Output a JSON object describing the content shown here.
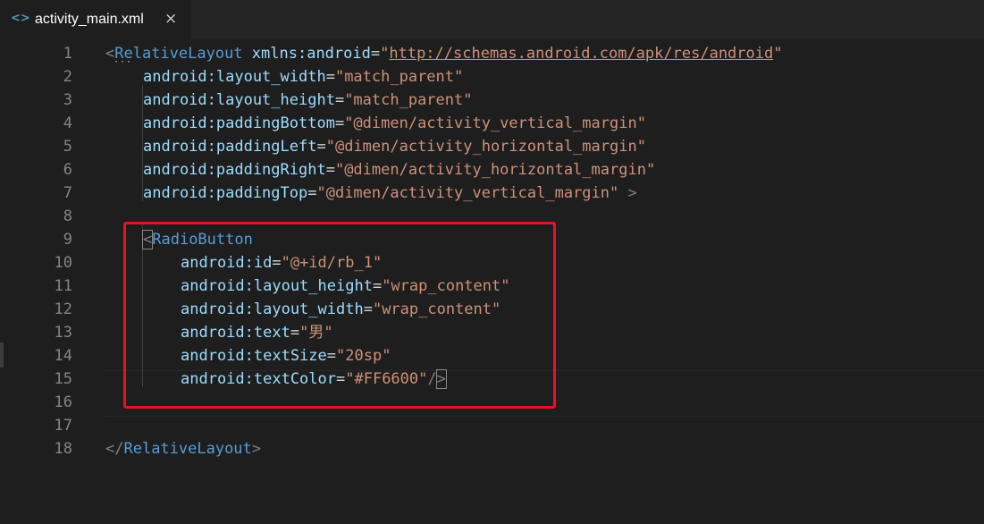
{
  "tab": {
    "icon": "code-icon",
    "icon_glyph": "<>",
    "label": "activity_main.xml",
    "close_glyph": "×"
  },
  "colors": {
    "highlight_box": "#e81123",
    "tag": "#569cd6",
    "attribute": "#9cdcfe",
    "string": "#ce9178",
    "punctuation": "#808080"
  },
  "lines": [
    {
      "n": "1"
    },
    {
      "n": "2"
    },
    {
      "n": "3"
    },
    {
      "n": "4"
    },
    {
      "n": "5"
    },
    {
      "n": "6"
    },
    {
      "n": "7"
    },
    {
      "n": "8"
    },
    {
      "n": "9"
    },
    {
      "n": "10"
    },
    {
      "n": "11"
    },
    {
      "n": "12"
    },
    {
      "n": "13"
    },
    {
      "n": "14"
    },
    {
      "n": "15"
    },
    {
      "n": "16"
    },
    {
      "n": "17"
    },
    {
      "n": "18"
    }
  ],
  "code": {
    "l1": {
      "open": "<",
      "tag": "RelativeLayout",
      "attr": "xmlns:android",
      "eq": "=",
      "q1": "\"",
      "url": "http://schemas.android.com/apk/res/android",
      "q2": "\""
    },
    "l2": {
      "attr": "android:layout_width",
      "eq": "=",
      "val": "\"match_parent\""
    },
    "l3": {
      "attr": "android:layout_height",
      "eq": "=",
      "val": "\"match_parent\""
    },
    "l4": {
      "attr": "android:paddingBottom",
      "eq": "=",
      "val": "\"@dimen/activity_vertical_margin\""
    },
    "l5": {
      "attr": "android:paddingLeft",
      "eq": "=",
      "val": "\"@dimen/activity_horizontal_margin\""
    },
    "l6": {
      "attr": "android:paddingRight",
      "eq": "=",
      "val": "\"@dimen/activity_horizontal_margin\""
    },
    "l7": {
      "attr": "android:paddingTop",
      "eq": "=",
      "val": "\"@dimen/activity_vertical_margin\"",
      "close": " >"
    },
    "l9": {
      "open": "<",
      "tag": "RadioButton"
    },
    "l10": {
      "attr": "android:id",
      "eq": "=",
      "val": "\"@+id/rb_1\""
    },
    "l11": {
      "attr": "android:layout_height",
      "eq": "=",
      "val": "\"wrap_content\""
    },
    "l12": {
      "attr": "android:layout_width",
      "eq": "=",
      "val": "\"wrap_content\""
    },
    "l13": {
      "attr": "android:text",
      "eq": "=",
      "val": "\"男\""
    },
    "l14": {
      "attr": "android:textSize",
      "eq": "=",
      "val": "\"20sp\""
    },
    "l15": {
      "attr": "android:textColor",
      "eq": "=",
      "val": "\"#FF6600\"",
      "slash": "/",
      "close": ">"
    },
    "l18": {
      "open": "</",
      "tag": "RelativeLayout",
      "close": ">"
    }
  }
}
